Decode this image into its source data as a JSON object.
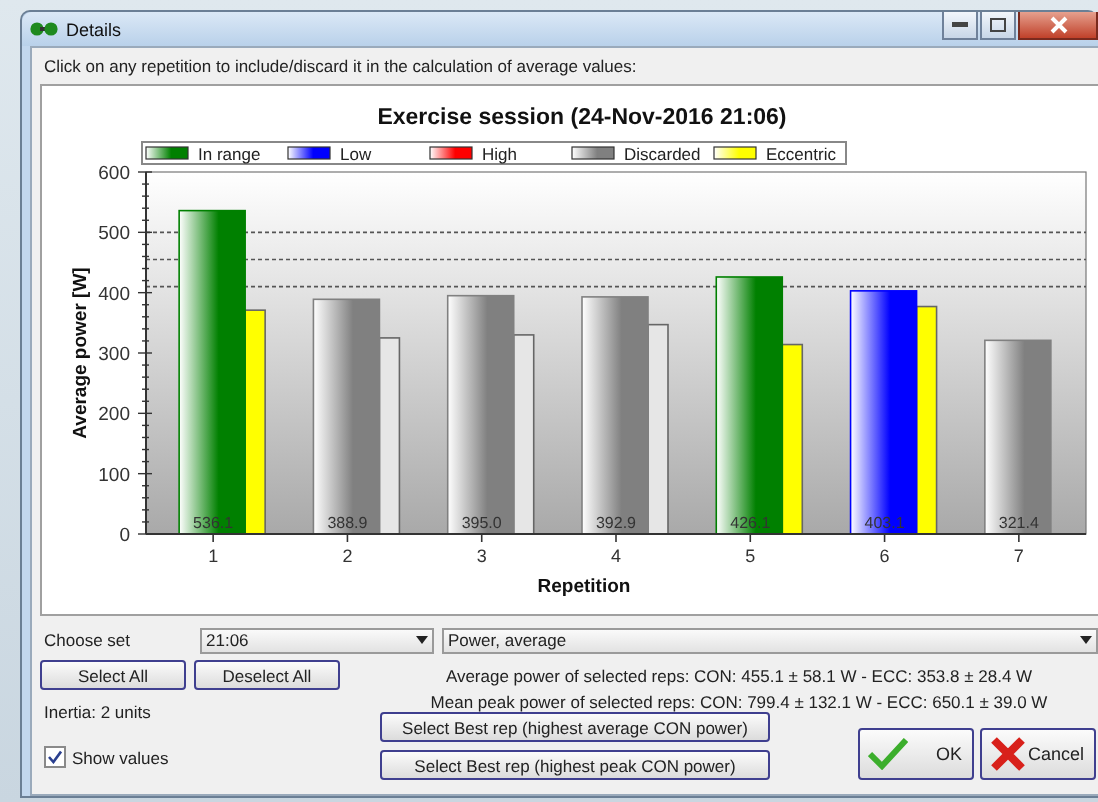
{
  "window": {
    "title": "Details"
  },
  "instruction": "Click on any repetition to include/discard it in the calculation of average values:",
  "legend": [
    {
      "label": "In range",
      "color": "#008000"
    },
    {
      "label": "Low",
      "color": "#0000ff"
    },
    {
      "label": "High",
      "color": "#ff0000"
    },
    {
      "label": "Discarded",
      "color": "#808080"
    },
    {
      "label": "Eccentric",
      "color": "#ffff00"
    }
  ],
  "chart_data": {
    "type": "bar",
    "title": "Exercise session (24-Nov-2016 21:06)",
    "xlabel": "Repetition",
    "ylabel": "Average power [W]",
    "categories": [
      "1",
      "2",
      "3",
      "4",
      "5",
      "6",
      "7"
    ],
    "series": [
      {
        "colors": [
          "#008000",
          "#808080",
          "#808080",
          "#808080",
          "#008000",
          "#0000ff",
          "#808080"
        ],
        "values": [
          536,
          389,
          395,
          393,
          426,
          403,
          321
        ]
      },
      {
        "colors": [
          "#ffff00",
          "#e6e6e6",
          "#e6e6e6",
          "#e6e6e6",
          "#ffff00",
          "#ffff00",
          null
        ],
        "values": [
          371,
          325,
          330,
          347,
          314,
          377,
          null
        ]
      }
    ],
    "ylim": [
      0,
      600
    ],
    "yticks": [
      0,
      100,
      200,
      300,
      400,
      500,
      600
    ],
    "value_labels": [
      "536.1",
      "388.9",
      "395.0",
      "392.9",
      "426.1",
      "403.1",
      "321.4"
    ],
    "ref_lines": [
      {
        "axis": "y",
        "value": 500
      },
      {
        "axis": "y",
        "value": 455
      },
      {
        "axis": "y",
        "value": 410
      }
    ]
  },
  "controls": {
    "choose_set_label": "Choose set",
    "set_value": "21:06",
    "metric_value": "Power, average",
    "select_all": "Select All",
    "deselect_all": "Deselect All",
    "average_text": "Average power of selected reps: CON: 455.1 ± 58.1 W - ECC: 353.8 ± 28.4 W",
    "peak_text": "Mean peak power of selected reps: CON: 799.4 ± 132.1 W - ECC: 650.1 ± 39.0 W",
    "inertia": "Inertia: 2 units",
    "best_avg": "Select Best rep (highest average CON power)",
    "best_peak": "Select Best rep (highest peak CON power)",
    "show_values": {
      "label": "Show values",
      "checked": true
    },
    "ok": "OK",
    "cancel": "Cancel"
  }
}
